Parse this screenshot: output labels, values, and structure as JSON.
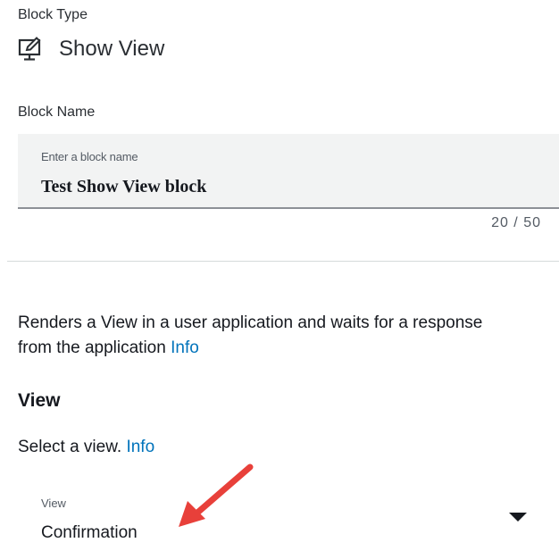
{
  "block_type": {
    "label": "Block Type",
    "value": "Show View",
    "icon": "monitor-edit-icon"
  },
  "block_name": {
    "label": "Block Name",
    "field_label": "Enter a block name",
    "value": "Test Show View block",
    "counter": "20 / 50"
  },
  "description": {
    "text": "Renders a View in a user application and waits for a response from the application ",
    "info_link": "Info"
  },
  "view_section": {
    "heading": "View",
    "help_text": "Select a view. ",
    "info_link": "Info",
    "field_label": "View",
    "selected_value": "Confirmation"
  },
  "colors": {
    "link": "#0073bb",
    "annotation_arrow": "#e8403a",
    "field_background": "#f2f3f3"
  }
}
